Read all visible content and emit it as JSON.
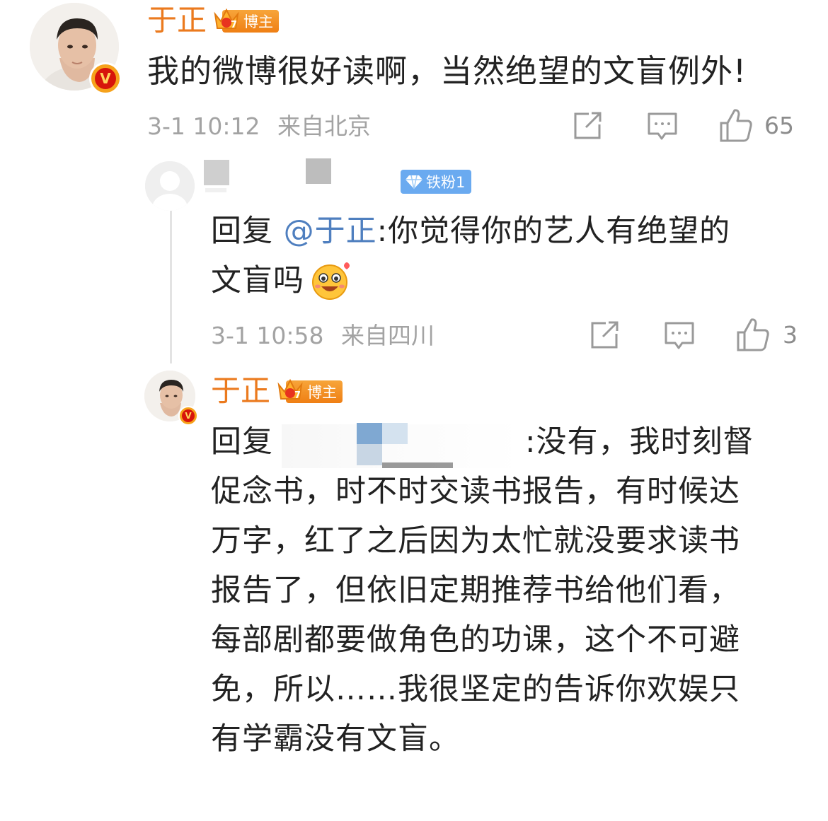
{
  "post": {
    "author": "于正",
    "badge": "博主",
    "crown_level": "7",
    "verified_mark": "V",
    "text": "我的微博很好读啊，当然绝望的文盲例外!",
    "time": "3-1 10:12",
    "source": "来自北京",
    "likes": "65"
  },
  "reply": {
    "badge": "铁粉1",
    "prefix": "回复",
    "mention": "@于正",
    "text_line1": ":你觉得你的艺人有绝望的",
    "text_line2": "文盲吗",
    "emoji": "smiling-face-emoji",
    "time": "3-1 10:58",
    "source": "来自四川",
    "likes": "3"
  },
  "sub_reply": {
    "author": "于正",
    "badge": "博主",
    "crown_level": "7",
    "verified_mark": "V",
    "prefix": "回复",
    "line1_tail": ":没有，我时刻督",
    "lines": [
      "促念书，时不时交读书报告，有时候达",
      "万字，红了之后因为太忙就没要求读书",
      "报告了，但依旧定期推荐书给他们看，",
      "每部剧都要做角色的功课，这个不可避",
      "免，所以……我很坚定的告诉你欢娱只",
      "有学霸没有文盲。"
    ]
  },
  "icons": {
    "share": "share-icon",
    "comment": "comment-icon",
    "like": "thumbs-up-icon"
  },
  "colors": {
    "username": "#eb7a1e",
    "badge_orange": "#f08a1e",
    "fan_badge_blue": "#5ea3ee",
    "mention": "#4f7fbf",
    "meta_gray": "#a3a3a3",
    "verified_red": "#d7150b"
  }
}
